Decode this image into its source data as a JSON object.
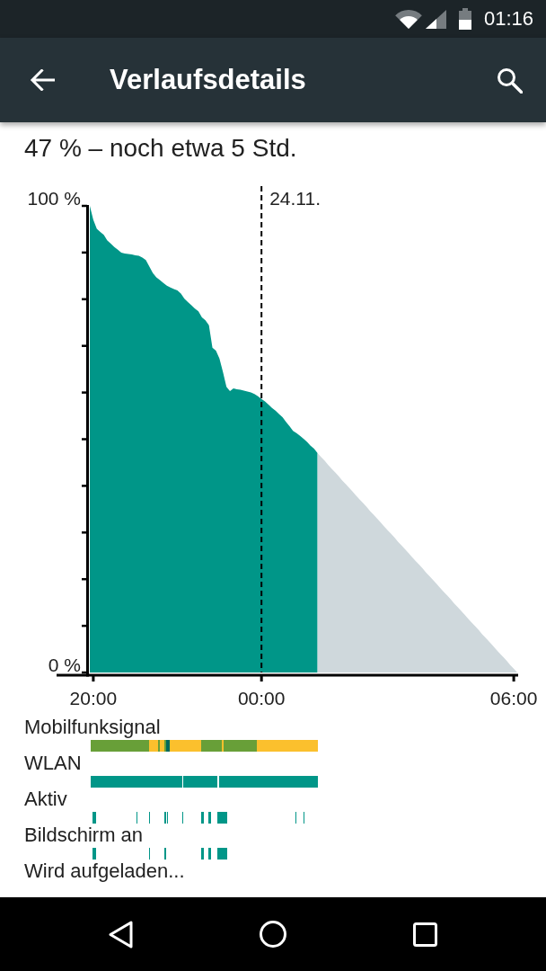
{
  "status_bar": {
    "time": "01:16"
  },
  "app_bar": {
    "title": "Verlaufsdetails"
  },
  "summary": "47 % – noch etwa 5 Std.",
  "chart": {
    "chart_data": {
      "type": "area",
      "categories": [
        null,
        "20:00",
        null,
        null,
        null,
        null,
        null,
        null,
        null,
        null,
        null,
        null,
        null,
        null,
        null,
        null,
        null,
        null,
        null,
        null,
        null,
        null,
        null,
        null,
        null,
        null,
        null,
        null,
        null,
        null,
        null,
        null,
        null,
        null,
        null,
        null,
        null,
        null,
        null,
        null,
        null,
        null,
        null,
        null,
        null,
        null,
        null,
        null,
        null,
        "00:00",
        null,
        null,
        null,
        null,
        null,
        null,
        null,
        null,
        null,
        null,
        null,
        null,
        null,
        null,
        null,
        null,
        null,
        null,
        null,
        null,
        null,
        null,
        null,
        null,
        null,
        null,
        null,
        null,
        null,
        null,
        null,
        null,
        null,
        null,
        null,
        null,
        null,
        null,
        null,
        null,
        null,
        null,
        null,
        null,
        null,
        null,
        null,
        null,
        null,
        null,
        null,
        null,
        null,
        null,
        null,
        null,
        null,
        null,
        null,
        null,
        null,
        null,
        null,
        null,
        null,
        null,
        null,
        null,
        null,
        null,
        null,
        "06:00",
        null
      ],
      "series": [
        {
          "color": "#009688",
          "values": [
            100,
            97.0,
            95.1,
            94.4,
            93.8,
            92.6,
            91.9,
            91.2,
            90.6,
            90.0,
            89.8,
            89.7,
            89.6,
            89.4,
            89.3,
            88.9,
            88.4,
            87.0,
            85.6,
            84.7,
            84.1,
            83.5,
            82.9,
            82.5,
            82.2,
            81.9,
            81.2,
            80.1,
            79.4,
            78.7,
            78.0,
            77.4,
            76.1,
            75.5,
            74.4,
            69.6,
            69.0,
            67.3,
            64.4,
            61.2,
            60.3,
            60.9,
            60.7,
            60.6,
            60.4,
            60.2,
            60.0,
            59.7,
            59.2,
            58.6,
            58.1,
            57.4,
            56.7,
            56.1,
            55.4,
            54.7,
            53.7,
            52.8,
            51.8,
            51.3,
            50.7,
            50.1,
            49.4,
            48.6,
            48.0,
            47.0,
            null,
            null,
            null,
            null,
            null,
            null,
            null,
            null,
            null,
            null,
            null,
            null,
            null,
            null,
            null,
            null,
            null,
            null,
            null,
            null,
            null,
            null,
            null,
            null,
            null,
            null,
            null,
            null,
            null,
            null,
            null,
            null,
            null,
            null,
            null,
            null,
            null,
            null,
            null,
            null,
            null,
            null,
            null,
            null,
            null,
            null,
            null,
            null,
            null,
            null,
            null,
            null,
            null,
            null,
            null,
            null,
            null
          ]
        },
        {
          "color": "#cfd8dc",
          "values": [
            null,
            null,
            null,
            null,
            null,
            null,
            null,
            null,
            null,
            null,
            null,
            null,
            null,
            null,
            null,
            null,
            null,
            null,
            null,
            null,
            null,
            null,
            null,
            null,
            null,
            null,
            null,
            null,
            null,
            null,
            null,
            null,
            null,
            null,
            null,
            null,
            null,
            null,
            null,
            null,
            null,
            null,
            null,
            null,
            null,
            null,
            null,
            null,
            null,
            null,
            null,
            null,
            null,
            null,
            null,
            null,
            null,
            null,
            null,
            null,
            null,
            null,
            null,
            null,
            null,
            47.0,
            46.2,
            45.4,
            44.5,
            43.7,
            42.9,
            42.1,
            41.2,
            40.4,
            39.6,
            38.8,
            37.9,
            37.1,
            36.3,
            35.5,
            34.6,
            33.8,
            33.0,
            32.2,
            31.3,
            30.5,
            29.7,
            28.9,
            28.0,
            27.2,
            26.4,
            25.6,
            24.7,
            23.9,
            23.1,
            22.3,
            21.4,
            20.6,
            19.8,
            19.0,
            18.1,
            17.3,
            16.5,
            15.7,
            14.8,
            14.0,
            13.2,
            12.4,
            11.5,
            10.7,
            9.9,
            9.1,
            8.2,
            7.4,
            6.6,
            5.8,
            4.9,
            4.1,
            3.3,
            2.5,
            1.6,
            0.8,
            0
          ]
        }
      ],
      "ylim": [
        0,
        100
      ],
      "yticks": [
        {
          "value": 0,
          "label": "0 %"
        },
        {
          "value": 100,
          "label": "100 %"
        }
      ],
      "annotations": [
        "24.11."
      ]
    },
    "tracks": [
      {
        "label": "Mobilfunksignal",
        "segments": [
          {
            "color": "#689f38"
          },
          {
            "color": "#fbc02d"
          },
          {
            "color": "#689f38"
          },
          {
            "color": "#fbc02d"
          },
          {
            "color": "#689f38"
          },
          {
            "color": "#00695c"
          },
          {
            "color": "#fbc02d"
          },
          {
            "color": "#689f38"
          },
          {
            "color": "#fbc02d"
          },
          {
            "color": "#689f38"
          },
          {
            "color": "#fbc02d"
          }
        ]
      },
      {
        "label": "WLAN"
      },
      {
        "label": "Aktiv"
      },
      {
        "label": "Bildschirm an"
      },
      {
        "label": "Wird aufgeladen..."
      }
    ]
  }
}
